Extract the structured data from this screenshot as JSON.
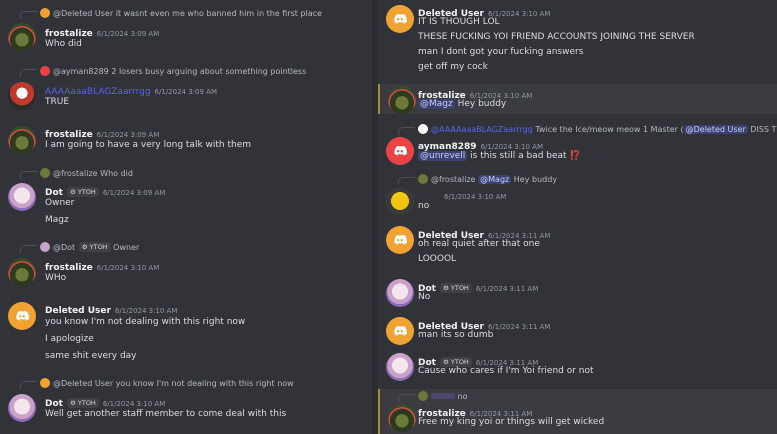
{
  "left": {
    "messages": [
      {
        "reply_author": "@Deleted User",
        "reply_text": "it wasnt even me who banned him in the first place",
        "author": "frostalize",
        "timestamp": "6/1/2024 3:09 AM",
        "lines": [
          "Who did"
        ]
      },
      {
        "reply_author": "@ayman8289",
        "reply_text": "2 losers busy arguing about something pointless",
        "author": "AAAAaaaBLAGZaarrrgg",
        "timestamp": "6/1/2024 3:09 AM",
        "lines": [
          "TRUE"
        ]
      },
      {
        "author": "frostalize",
        "timestamp": "6/1/2024 3:09 AM",
        "lines": [
          "I am going to have a very long talk with them"
        ]
      },
      {
        "reply_author": "@frostalize",
        "reply_text": "Who did",
        "author": "Dot",
        "tag": "YTOH",
        "timestamp": "6/1/2024 3:09 AM",
        "lines": [
          "Owner",
          "Magz"
        ]
      },
      {
        "reply_author": "@Dot",
        "reply_tag": "YTOH",
        "reply_text": "Owner",
        "author": "frostalize",
        "timestamp": "6/1/2024 3:10 AM",
        "lines": [
          "WHo"
        ]
      },
      {
        "author": "Deleted User",
        "timestamp": "6/1/2024 3:10 AM",
        "lines": [
          "you know I'm not dealing with this right now",
          "I apologize",
          "same shit every day"
        ]
      },
      {
        "reply_author": "@Deleted User",
        "reply_text": "you know I'm not dealing with this right now",
        "author": "Dot",
        "tag": "YTOH",
        "timestamp": "6/1/2024 3:10 AM",
        "lines": [
          "Well get another staff member to come deal with this"
        ]
      }
    ]
  },
  "right": {
    "messages": [
      {
        "author": "Deleted User",
        "timestamp": "6/1/2024 3:10 AM",
        "lines": [
          "IT IS THOUGH LOL",
          "THESE FUCKING YOI FRIEND ACCOUNTS JOINING THE SERVER",
          "man I dont got your fucking answers",
          "get off my cock"
        ]
      },
      {
        "author": "frostalize",
        "timestamp": "6/1/2024 3:10 AM",
        "mention": "@Magz",
        "text_after_mention": " Hey buddy"
      },
      {
        "reply_author": "@AAAAaaaBLAGZaarrrgg",
        "reply_text": "Twice the Ice/meow meow 1 Master (",
        "reply_mention": "@Deleted User",
        "reply_text_after": " DISS TRACK)",
        "author": "ayman8289",
        "timestamp": "6/1/2024 3:10 AM",
        "mention": "@unrevell",
        "text_after_mention": " is this still a bad beat",
        "emoji": "⁉️"
      },
      {
        "reply_author": "@frostalize",
        "reply_mention": "@Magz",
        "reply_text_after": " Hey buddy",
        "author": "",
        "timestamp": "6/1/2024 3:10 AM",
        "lines": [
          "no"
        ]
      },
      {
        "author": "Deleted User",
        "timestamp": "6/1/2024 3:11 AM",
        "lines": [
          "oh real quiet after that one",
          "LOOOOL"
        ]
      },
      {
        "author": "Dot",
        "tag": "YTOH",
        "timestamp": "6/1/2024 3:11 AM",
        "lines": [
          "No"
        ]
      },
      {
        "author": "Deleted User",
        "timestamp": "6/1/2024 3:11 AM",
        "lines": [
          "man its so dumb"
        ]
      },
      {
        "author": "Dot",
        "tag": "YTOH",
        "timestamp": "6/1/2024 3:11 AM",
        "lines": [
          "Cause who cares if I'm Yoi friend or not"
        ]
      },
      {
        "reply_text": "no",
        "author": "frostalize",
        "timestamp": "6/1/2024 3:11 AM",
        "lines": [
          "Free my king yoi or things will get wicked"
        ]
      }
    ]
  },
  "colors": {
    "background": "#313338",
    "mention_bg": "#3c4270",
    "discord_orange": "#f0a232",
    "discord_red": "#ed4245",
    "link_blue": "#5865f2"
  }
}
